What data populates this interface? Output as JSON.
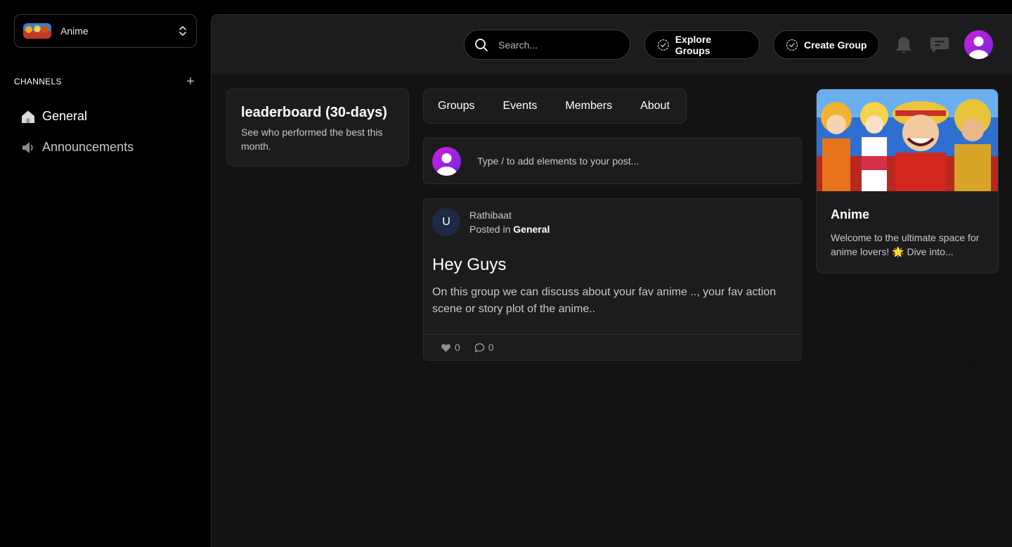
{
  "sidebar": {
    "group_name": "Anime",
    "channels_title": "CHANNELS",
    "channels": [
      {
        "label": "General",
        "icon": "home-icon"
      },
      {
        "label": "Announcements",
        "icon": "megaphone-icon"
      }
    ]
  },
  "topbar": {
    "search_placeholder": "Search...",
    "explore_label": "Explore Groups",
    "create_label": "Create Group"
  },
  "leaderboard": {
    "title": "leaderboard (30-days)",
    "subtitle": "See who performed the best this month."
  },
  "tabs": [
    "Groups",
    "Events",
    "Members",
    "About"
  ],
  "composer": {
    "placeholder": "Type / to add elements to your post..."
  },
  "post": {
    "avatar_initial": "U",
    "author": "Rathibaat",
    "posted_in_prefix": "Posted in",
    "channel": "General",
    "title": "Hey Guys",
    "body": "On this group we can discuss about your fav anime .., your fav action scene or story plot of the anime..",
    "likes": "0",
    "comments": "0"
  },
  "about": {
    "title": "Anime",
    "description": "Welcome to the ultimate space for anime lovers! 🌟 Dive into..."
  },
  "colors": {
    "background": "#000000",
    "panel": "#131314",
    "card": "#1c1c1e",
    "accent_gradient_start": "#c026d3",
    "accent_gradient_end": "#7c3aed"
  }
}
